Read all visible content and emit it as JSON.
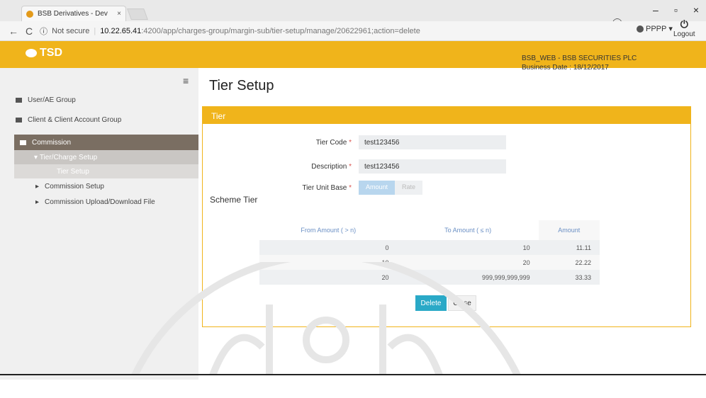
{
  "browser": {
    "tab_title": "BSB Derivatives - Dev",
    "tab_close": "×",
    "not_secure": "Not secure",
    "url_host": "10.22.65.41",
    "url_path": ":4200/app/charges-group/margin-sub/tier-setup/manage/20622961;action=delete",
    "back": "←",
    "reload": "C",
    "win_min": "–",
    "win_max": "▫",
    "win_close": "×",
    "account_icon": "person-circle-icon"
  },
  "header": {
    "logo": "TSD",
    "company": "BSB_WEB - BSB SECURITIES PLC",
    "business_date": "Business Date : 18/12/2017",
    "user": "PPPP",
    "logout": "Logout",
    "brand_color": "#f0b41b"
  },
  "sidebar": {
    "toggle": "≡",
    "items": [
      {
        "label": "User/AE Group"
      },
      {
        "label": "Client & Client Account Group"
      },
      {
        "label": "Commission"
      },
      {
        "label": "Tier/Charge Setup"
      },
      {
        "label": "Tier Setup"
      },
      {
        "label": "Commission Setup"
      },
      {
        "label": "Commission Upload/Download File"
      }
    ]
  },
  "main": {
    "title": "Tier Setup",
    "panel_title": "Tier",
    "form": {
      "tier_code_label": "Tier Code",
      "tier_code_value": "test123456",
      "description_label": "Description",
      "description_value": "test123456",
      "unit_base_label": "Tier Unit Base",
      "unit_base_options": [
        "Amount",
        "Rate"
      ],
      "required_mark": "*"
    },
    "scheme_title": "Scheme Tier",
    "table": {
      "headers": [
        "From Amount ( > n)",
        "To Amount ( ≤ n)",
        "Amount"
      ],
      "rows": [
        [
          "0",
          "10",
          "11.11"
        ],
        [
          "10",
          "20",
          "22.22"
        ],
        [
          "20",
          "999,999,999,999",
          "33.33"
        ]
      ]
    },
    "buttons": {
      "delete": "Delete",
      "close": "Close"
    }
  }
}
